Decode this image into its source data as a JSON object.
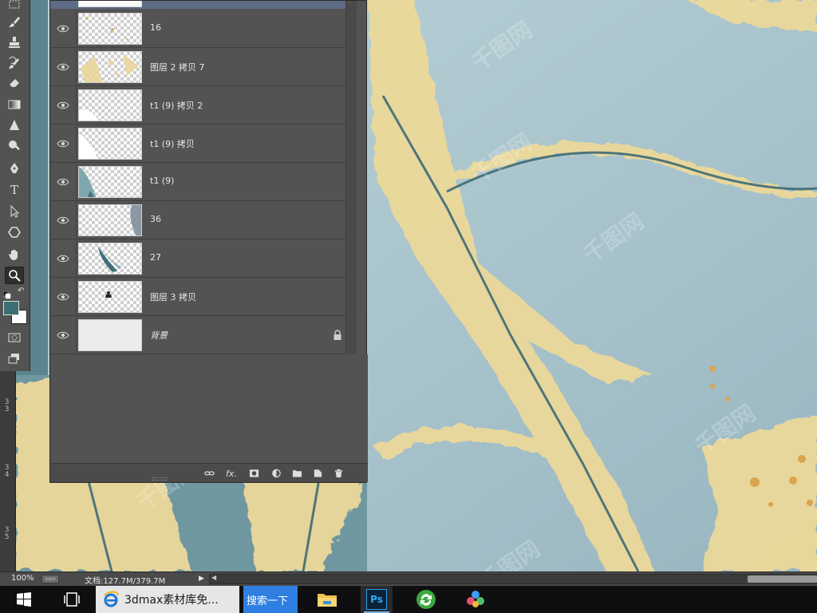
{
  "canvas": {
    "watermark": "千图网",
    "colors": {
      "teal_base": "#a9c4cd",
      "gold": "#eedda0",
      "dark_teal": "#3e6b75"
    }
  },
  "ruler": {
    "ticks": [
      {
        "a": "3",
        "b": "3"
      },
      {
        "a": "3",
        "b": "4"
      },
      {
        "a": "3",
        "b": "5"
      }
    ]
  },
  "toolbar": {
    "tools": [
      "marquee-icon",
      "brush-icon",
      "stamp-icon",
      "history-brush-icon",
      "eraser-icon",
      "gradient-icon",
      "blur-icon",
      "dodge-icon",
      "pen-icon",
      "type-icon",
      "path-select-icon",
      "shape-icon",
      "hand-icon",
      "zoom-icon"
    ],
    "type_label": "T",
    "foreground_color": "#3c6f73",
    "background_color": "#ffffff"
  },
  "layers": [
    {
      "name": "16",
      "thumb": "sparse-gold"
    },
    {
      "name": "图层 2 拷贝 7",
      "thumb": "gold-texture"
    },
    {
      "name": "t1 (9) 拷贝 2",
      "thumb": "white-corner"
    },
    {
      "name": "t1 (9) 拷贝",
      "thumb": "white-corner"
    },
    {
      "name": "t1 (9)",
      "thumb": "teal-corner"
    },
    {
      "name": "36",
      "thumb": "dark-edge"
    },
    {
      "name": "27",
      "thumb": "teal-stroke"
    },
    {
      "name": "图层 3 拷贝",
      "thumb": "small-figure"
    },
    {
      "name": "背景",
      "thumb": "solid",
      "locked": true,
      "italic": true
    }
  ],
  "panel_footer": {
    "buttons": [
      "link-icon",
      "fx",
      "mask-icon",
      "adjustment-icon",
      "folder-icon",
      "new-layer-icon",
      "trash-icon"
    ],
    "fx_label": "fx."
  },
  "status": {
    "zoom": "100%",
    "doc": "文档:127.7M/379.7M"
  },
  "taskbar": {
    "browser_label": "3dmax素材库免...",
    "search_label": "搜索一下",
    "ps_label": "Ps"
  }
}
